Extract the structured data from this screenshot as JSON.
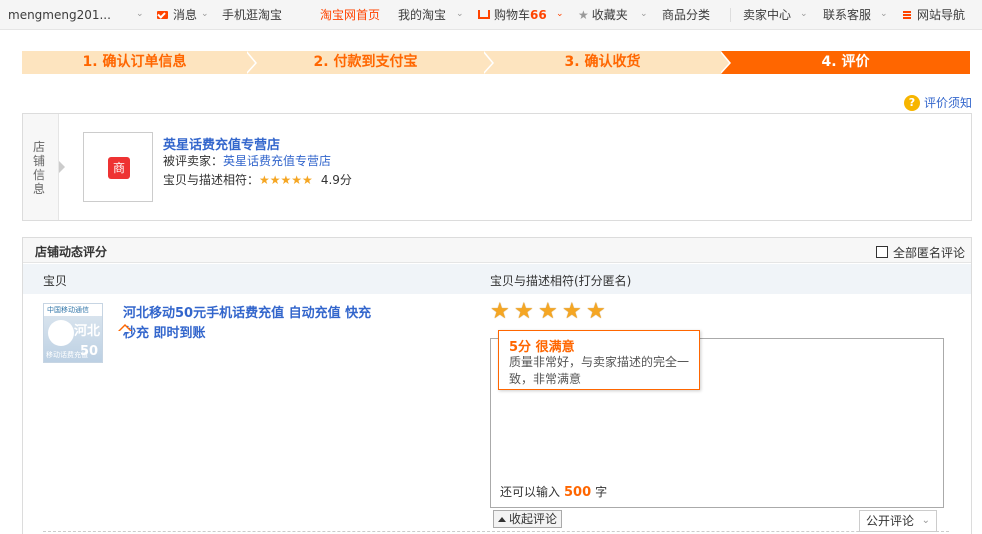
{
  "topbar": {
    "username": "mengmeng201...",
    "messages": "消息",
    "mobile": "手机逛淘宝",
    "home": "淘宝网首页",
    "my_taobao": "我的淘宝",
    "cart_label": "购物车",
    "cart_count": "66",
    "favorites": "收藏夹",
    "categories": "商品分类",
    "seller_center": "卖家中心",
    "support": "联系客服",
    "site_nav": "网站导航"
  },
  "steps": [
    {
      "label": "1. 确认订单信息"
    },
    {
      "label": "2. 付款到支付宝"
    },
    {
      "label": "3. 确认收货"
    },
    {
      "label": "4. 评价"
    }
  ],
  "help_link": "评价须知",
  "shop": {
    "side_label": "店铺信息",
    "name": "英星话费充值专营店",
    "seller_prefix": "被评卖家：",
    "seller_name": "英星话费充值专营店",
    "match_label": "宝贝与描述相符：",
    "stars": "★★★★★",
    "score": "4.9分"
  },
  "rating": {
    "section_title": "店铺动态评分",
    "anonymous_label": "全部匿名评论",
    "col_item": "宝贝",
    "col_match": "宝贝与描述相符(打分匿名)",
    "item_title": "河北移动50元手机话费充值 自动充值 快充 秒充 即时到账",
    "item_image": {
      "top": "中国移动通信",
      "province": "河北",
      "caption": "移动话费充值",
      "amount": "50"
    },
    "tooltip_title": "5分 很满意",
    "tooltip_body": "质量非常好，与卖家描述的完全一致，非常满意",
    "remain_prefix": "还可以输入",
    "remain_count": "500",
    "remain_suffix": "字",
    "collapse_label": "收起评论",
    "visibility_value": "公开评论"
  }
}
